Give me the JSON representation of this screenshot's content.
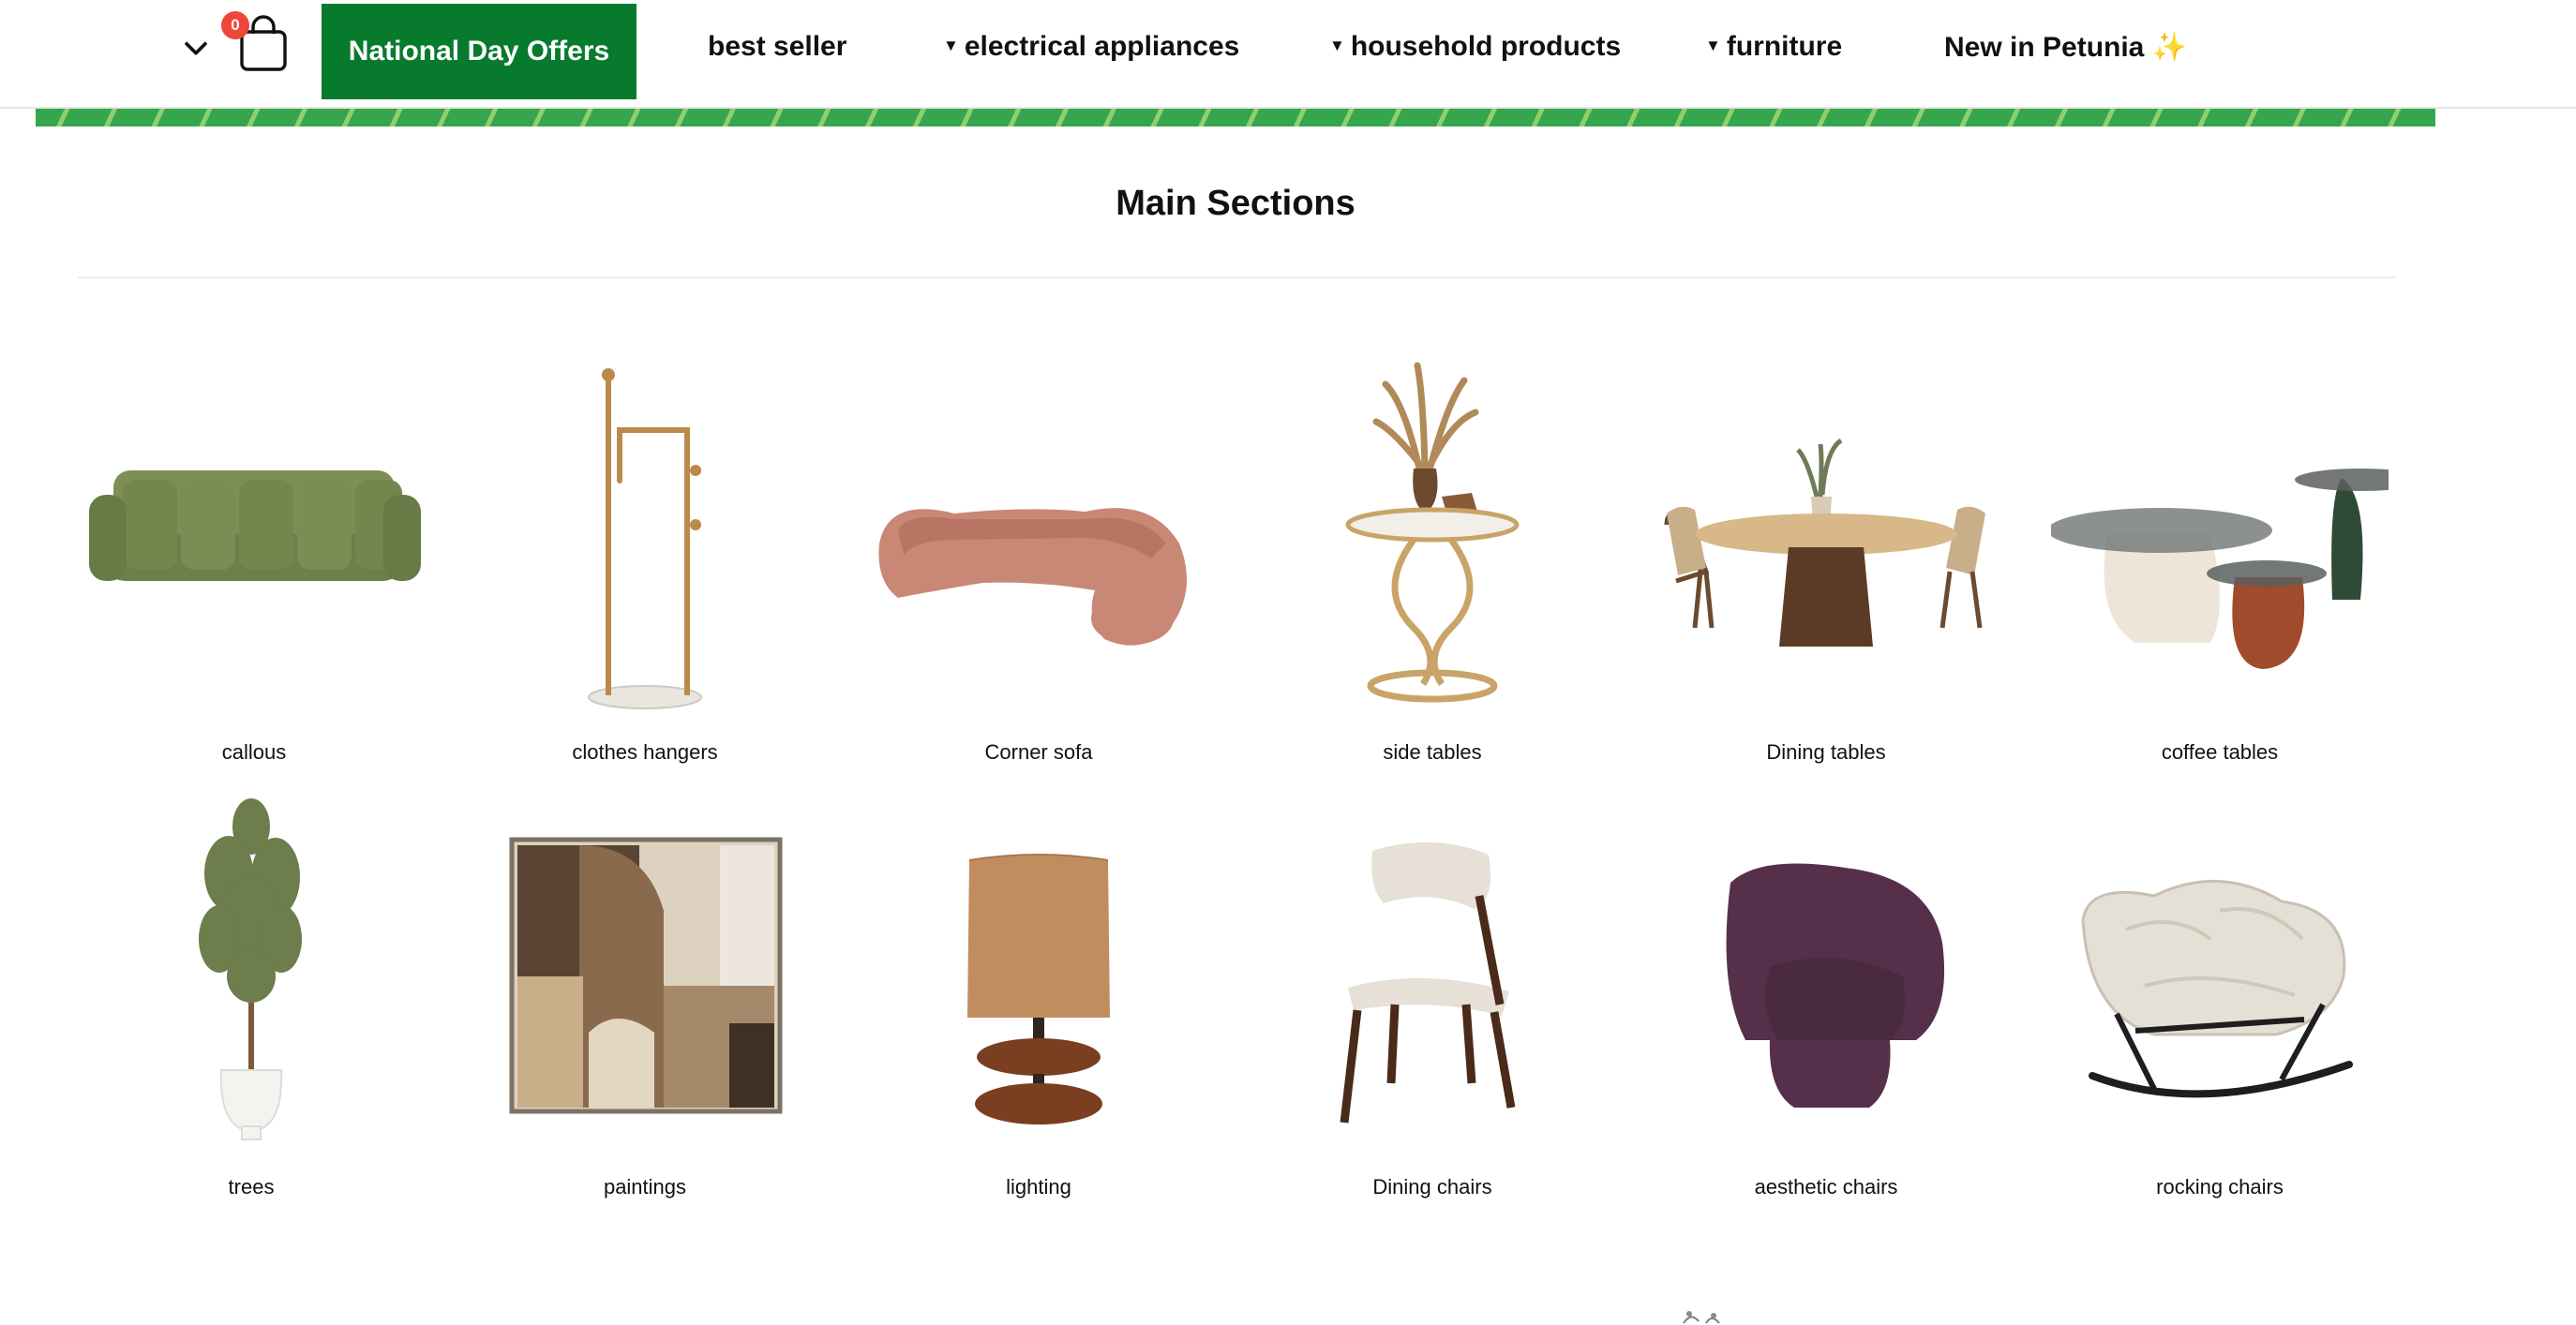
{
  "navbar": {
    "cart_count": "0",
    "items": [
      {
        "label": "National Day Offers",
        "dropdown": false
      },
      {
        "label": "best seller",
        "dropdown": false
      },
      {
        "label": "electrical appliances",
        "dropdown": true
      },
      {
        "label": "household products",
        "dropdown": true
      },
      {
        "label": "furniture",
        "dropdown": true
      },
      {
        "label": "New in Petunia ✨",
        "dropdown": false
      }
    ]
  },
  "main": {
    "title": "Main Sections",
    "categories": [
      {
        "label": "callous",
        "icon": "green-sofa-image"
      },
      {
        "label": "clothes hangers",
        "icon": "clothes-hanger-image"
      },
      {
        "label": "Corner sofa",
        "icon": "corner-sofa-image"
      },
      {
        "label": "side tables",
        "icon": "side-table-image"
      },
      {
        "label": "Dining tables",
        "icon": "dining-table-image"
      },
      {
        "label": "coffee tables",
        "icon": "coffee-tables-image"
      },
      {
        "label": "trees",
        "icon": "potted-tree-image"
      },
      {
        "label": "paintings",
        "icon": "painting-image"
      },
      {
        "label": "lighting",
        "icon": "table-lamp-image"
      },
      {
        "label": "Dining chairs",
        "icon": "dining-chair-image"
      },
      {
        "label": "aesthetic chairs",
        "icon": "armchair-image"
      },
      {
        "label": "rocking chairs",
        "icon": "rocking-chair-image"
      }
    ]
  },
  "colors": {
    "brand_green": "#087a2e",
    "stripe_green": "#35a64d",
    "badge_red": "#f0453a"
  }
}
